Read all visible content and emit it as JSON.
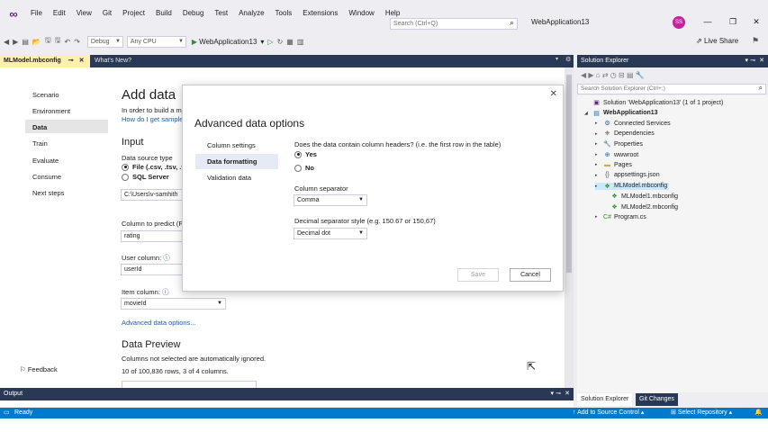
{
  "menubar": {
    "items": [
      "File",
      "Edit",
      "View",
      "Git",
      "Project",
      "Build",
      "Debug",
      "Test",
      "Analyze",
      "Tools",
      "Extensions",
      "Window",
      "Help"
    ],
    "search_placeholder": "Search (Ctrl+Q)",
    "app_name": "WebApplication13",
    "avatar_initials": "SS"
  },
  "toolbar": {
    "config": "Debug",
    "platform": "Any CPU",
    "run_label": "WebApplication13",
    "live_share": "Live Share"
  },
  "tabs": {
    "active": "MLModel.mbconfig",
    "other": "What's New?"
  },
  "wizard": {
    "nav": [
      "Scenario",
      "Environment",
      "Data",
      "Train",
      "Evaluate",
      "Consume",
      "Next steps"
    ],
    "selected": "Data",
    "feedback": "Feedback",
    "heading": "Add data",
    "intro_line": "In order to build a m",
    "intro_link": "How do I get sample",
    "input_heading": "Input",
    "data_source_label": "Data source type",
    "source_file": "File (.csv, .tsv, .tx",
    "source_sql": "SQL Server",
    "file_path": "C:\\Users\\v-samhith",
    "predict_label": "Column to predict (F",
    "predict_value": "rating",
    "user_label": "User column:",
    "user_value": "userId",
    "item_label": "Item column:",
    "item_value": "movieId",
    "advanced_link": "Advanced data options...",
    "preview_heading": "Data Preview",
    "preview_note": "Columns not selected are automatically ignored.",
    "preview_count": "10 of 100,836 rows, 3 of 4 columns."
  },
  "dialog": {
    "title": "Advanced data options",
    "nav": [
      "Column settings",
      "Data formatting",
      "Validation data"
    ],
    "selected": "Data formatting",
    "headers_question": "Does the data contain column headers? (i.e. the first row in the table)",
    "yes": "Yes",
    "no": "No",
    "separator_label": "Column separator",
    "separator_value": "Comma",
    "decimal_label": "Decimal separator style (e.g. 150.67 or 150,67)",
    "decimal_value": "Decimal dot",
    "save": "Save",
    "cancel": "Cancel"
  },
  "solution_explorer": {
    "title": "Solution Explorer",
    "search_placeholder": "Search Solution Explorer (Ctrl+;)",
    "items": [
      {
        "label": "Solution 'WebApplication13' (1 of 1 project)",
        "icon": "solution-icon"
      },
      {
        "label": "WebApplication13",
        "icon": "project-icon"
      },
      {
        "label": "Connected Services",
        "icon": "connected-icon"
      },
      {
        "label": "Dependencies",
        "icon": "dependencies-icon"
      },
      {
        "label": "Properties",
        "icon": "properties-icon"
      },
      {
        "label": "wwwroot",
        "icon": "globe-icon"
      },
      {
        "label": "Pages",
        "icon": "folder-icon"
      },
      {
        "label": "appsettings.json",
        "icon": "json-icon"
      },
      {
        "label": "MLModel.mbconfig",
        "icon": "mbconfig-icon"
      },
      {
        "label": "MLModel1.mbconfig",
        "icon": "mbconfig-icon"
      },
      {
        "label": "MLModel2.mbconfig",
        "icon": "mbconfig-icon"
      },
      {
        "label": "Program.cs",
        "icon": "csharp-icon"
      }
    ],
    "tab_solution": "Solution Explorer",
    "tab_git": "Git Changes"
  },
  "output": {
    "title": "Output"
  },
  "statusbar": {
    "ready": "Ready",
    "source_control": "Add to Source Control",
    "select_repo": "Select Repository"
  },
  "colors": {
    "accent": "#007acc",
    "tab_strip": "#293955",
    "active_tab": "#fff0b0"
  }
}
